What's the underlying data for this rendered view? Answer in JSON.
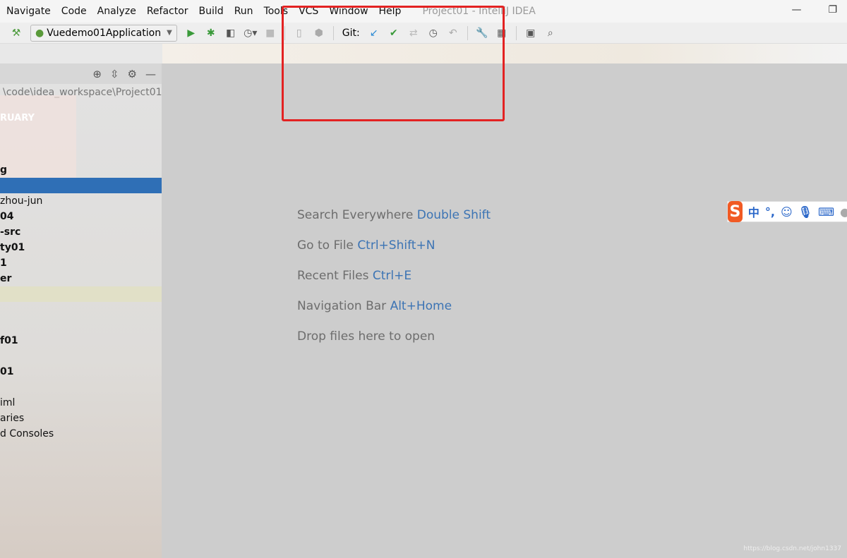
{
  "menu": [
    "Navigate",
    "Code",
    "Analyze",
    "Refactor",
    "Build",
    "Run",
    "Tools",
    "VCS",
    "Window",
    "Help"
  ],
  "title": "Project01 - IntelliJ IDEA",
  "toolbar": {
    "run_config": "Vuedemo01Application",
    "git_label": "Git:"
  },
  "sidebar": {
    "path": "\\code\\idea_workspace\\Project01",
    "calendar_month": "RUARY",
    "rows": [
      {
        "t": "g",
        "b": true
      },
      {
        "t": "",
        "sel": true
      },
      {
        "t": "zhou-jun"
      },
      {
        "t": "04",
        "b": true
      },
      {
        "t": "-src",
        "b": true
      },
      {
        "t": "ty01",
        "b": true
      },
      {
        "t": "1",
        "b": true
      },
      {
        "t": "er",
        "b": true
      },
      {
        "t": "",
        "hl": true
      },
      {
        "t": ""
      },
      {
        "t": ""
      },
      {
        "t": "f01",
        "b": true
      },
      {
        "t": ""
      },
      {
        "t": "01",
        "b": true
      },
      {
        "t": ""
      },
      {
        "t": "iml"
      },
      {
        "t": "aries"
      },
      {
        "t": "d Consoles"
      }
    ]
  },
  "hints": [
    {
      "label": "Search Everywhere",
      "key": "Double Shift"
    },
    {
      "label": "Go to File",
      "key": "Ctrl+Shift+N"
    },
    {
      "label": "Recent Files",
      "key": "Ctrl+E"
    },
    {
      "label": "Navigation Bar",
      "key": "Alt+Home"
    },
    {
      "label": "Drop files here to open",
      "key": ""
    }
  ],
  "ime": {
    "logo": "S",
    "lang": "中",
    "punct": "°,"
  },
  "watermark": "https://blog.csdn.net/john1337",
  "colors": {
    "accent": "#3c74b4",
    "selection": "#2f6fb6",
    "annotation": "#e32222"
  }
}
